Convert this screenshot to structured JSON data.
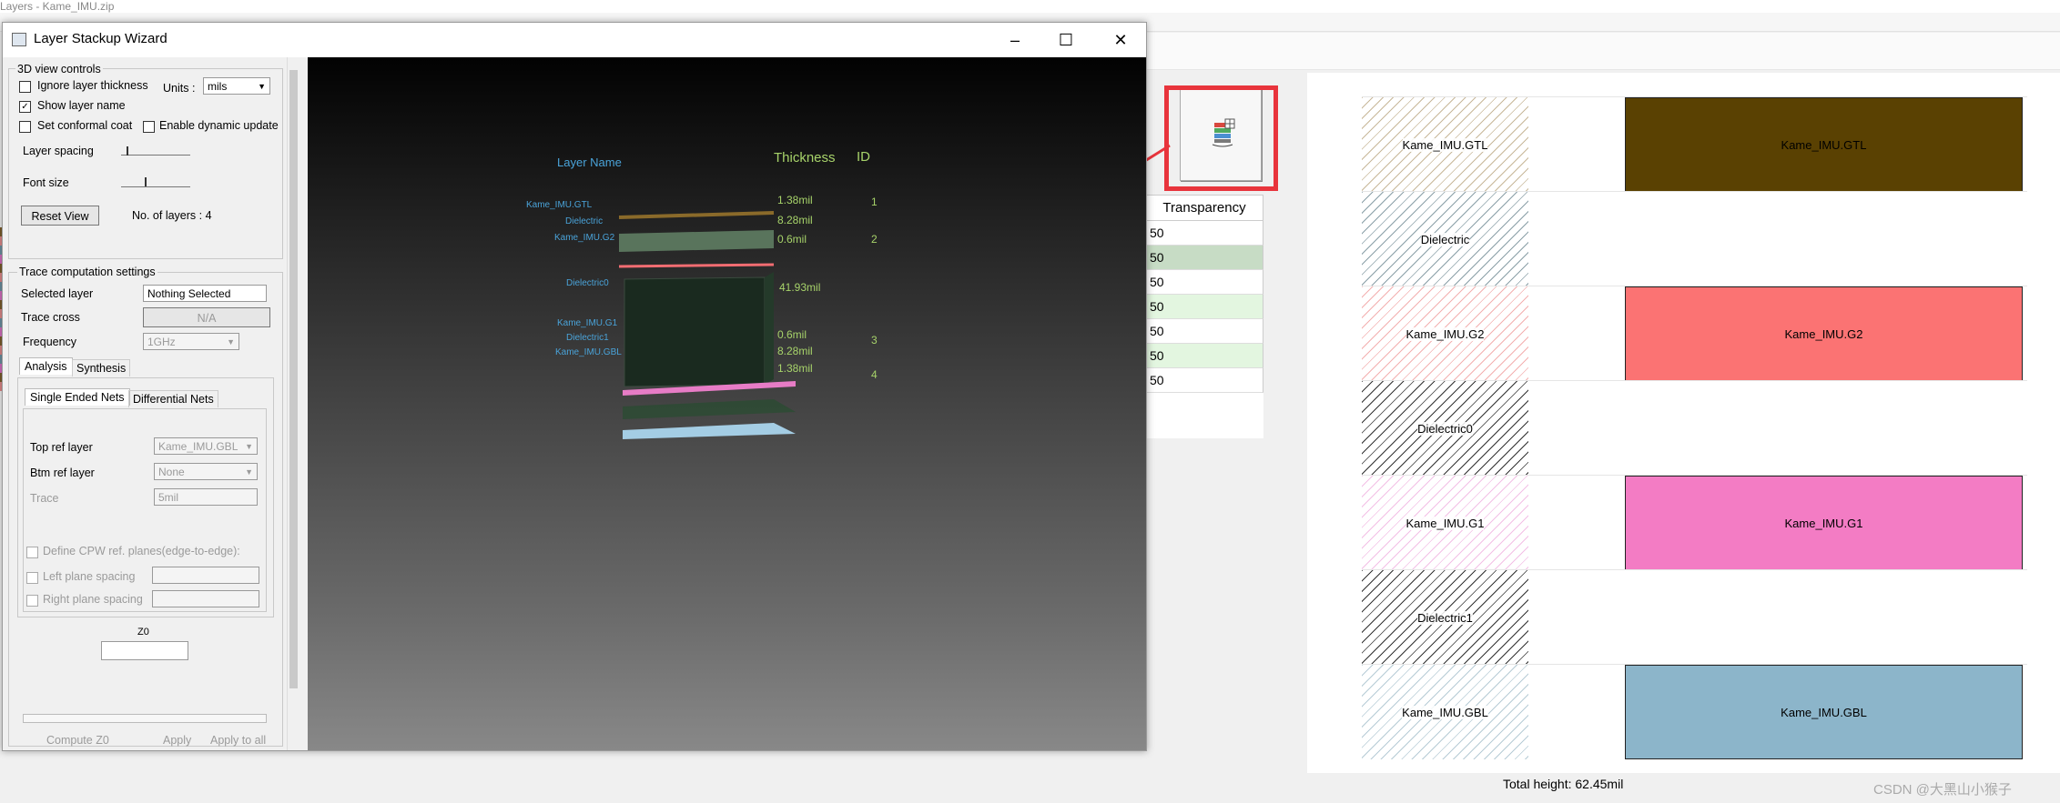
{
  "background": {
    "title_fragment": "Layers - Kame_IMU.zip",
    "left_strip_colors": [
      "#7a5c2a",
      "#dd8888",
      "#6a8fa0",
      "#d46fbf"
    ]
  },
  "toolbar_button": {
    "icon": "layer-stack-3d-icon"
  },
  "transparency_table": {
    "header": "Transparency",
    "rows": [
      {
        "value": "50",
        "bg": "#ffffff"
      },
      {
        "value": "50",
        "bg": "#c7dcc5"
      },
      {
        "value": "50",
        "bg": "#ffffff"
      },
      {
        "value": "50",
        "bg": "#e3f6e0"
      },
      {
        "value": "50",
        "bg": "#ffffff"
      },
      {
        "value": "50",
        "bg": "#e3f6e0"
      },
      {
        "value": "50",
        "bg": "#ffffff"
      }
    ]
  },
  "stackup": {
    "layers": [
      {
        "name": "Kame_IMU.GTL",
        "hatch": "#c8b89a",
        "color": "#5a4102",
        "conductor": true
      },
      {
        "name": "Dielectric",
        "hatch": "#8ba0a8",
        "color": null,
        "conductor": false
      },
      {
        "name": "Kame_IMU.G2",
        "hatch": "#f3b0b0",
        "color": "#fb7373",
        "conductor": true
      },
      {
        "name": "Dielectric0",
        "hatch": "#333333",
        "color": null,
        "conductor": false
      },
      {
        "name": "Kame_IMU.G1",
        "hatch": "#f3c0e6",
        "color": "#f37cc4",
        "conductor": true
      },
      {
        "name": "Dielectric1",
        "hatch": "#333333",
        "color": null,
        "conductor": false
      },
      {
        "name": "Kame_IMU.GBL",
        "hatch": "#b7ccd6",
        "color": "#8cb5ca",
        "conductor": true
      }
    ],
    "total_height": "Total height: 62.45mil"
  },
  "watermark": "CSDN @大黑山小猴子",
  "wizard": {
    "title": "Layer Stackup Wizard",
    "view_controls": {
      "group_label": "3D view controls",
      "ignore_thickness": "Ignore layer thickness",
      "ignore_thickness_checked": false,
      "units_label": "Units :",
      "units_value": "mils",
      "show_layer_name": "Show layer name",
      "show_layer_name_checked": true,
      "set_conformal_coat": "Set conformal coat",
      "enable_dynamic_update": "Enable dynamic update",
      "layer_spacing": "Layer spacing",
      "font_size": "Font size",
      "reset_view": "Reset View",
      "no_of_layers": "No. of layers : 4"
    },
    "trace": {
      "group_label": "Trace computation settings",
      "selected_layer_label": "Selected layer",
      "selected_layer_value": "Nothing Selected",
      "trace_cross_label": "Trace cross",
      "trace_cross_value": "N/A",
      "frequency_label": "Frequency",
      "frequency_value": "1GHz",
      "tabs": [
        "Analysis",
        "Synthesis"
      ],
      "subtabs": [
        "Single Ended Nets",
        "Differential Nets"
      ],
      "top_ref_label": "Top ref layer",
      "top_ref_value": "Kame_IMU.GBL",
      "btm_ref_label": "Btm ref layer",
      "btm_ref_value": "None",
      "trace_label": "Trace",
      "trace_value": "5mil",
      "define_cpw": "Define CPW ref. planes(edge-to-edge):",
      "left_plane": "Left plane spacing",
      "right_plane": "Right plane spacing",
      "z0_label": "Z0",
      "compute_z0": "Compute Z0",
      "apply": "Apply",
      "apply_all": "Apply to all"
    },
    "view3d": {
      "header_name": "Layer Name",
      "header_thickness": "Thickness",
      "header_id": "ID",
      "layers": [
        {
          "name": "Kame_IMU.GTL",
          "thickness": "1.38mil",
          "id": "1"
        },
        {
          "name": "Dielectric",
          "thickness": "8.28mil",
          "id": ""
        },
        {
          "name": "Kame_IMU.G2",
          "thickness": "0.6mil",
          "id": "2"
        },
        {
          "name": "Dielectric0",
          "thickness": "41.93mil",
          "id": ""
        },
        {
          "name": "Kame_IMU.G1",
          "thickness": "0.6mil",
          "id": ""
        },
        {
          "name": "Dielectric1",
          "thickness": "8.28mil",
          "id": "3"
        },
        {
          "name": "Kame_IMU.GBL",
          "thickness": "1.38mil",
          "id": "4"
        }
      ]
    }
  }
}
